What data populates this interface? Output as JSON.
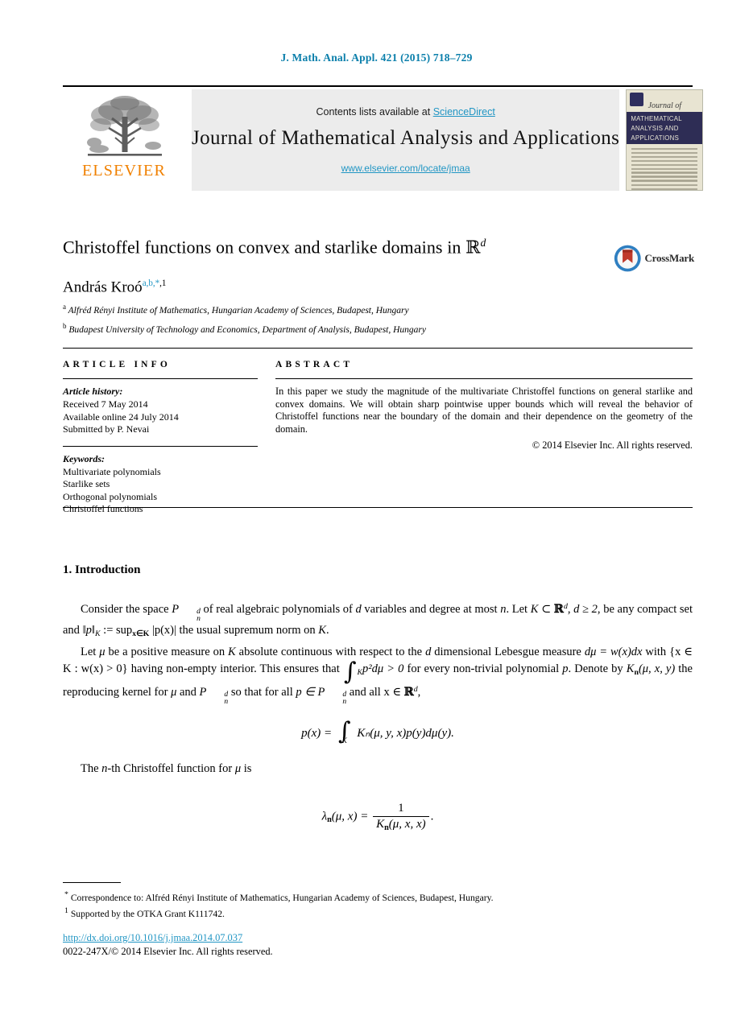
{
  "running_head": "J. Math. Anal. Appl. 421 (2015) 718–729",
  "masthead": {
    "contents_prefix": "Contents lists available at ",
    "sciencedirect": "ScienceDirect",
    "journal_title": "Journal of Mathematical Analysis and Applications",
    "journal_url": "www.elsevier.com/locate/jmaa",
    "publisher_wordmark": "ELSEVIER",
    "cover": {
      "script_word": "Journal of",
      "band_line1": "MATHEMATICAL",
      "band_line2": "ANALYSIS AND",
      "band_line3": "APPLICATIONS"
    }
  },
  "title": {
    "main": "Christoffel functions on convex and starlike domains in",
    "domain_symbol": "ℝ",
    "domain_exponent": "d"
  },
  "author": {
    "name": "András Kroó",
    "marks_linked": "a,b,*",
    "marks_plain": ",1"
  },
  "affiliations": [
    {
      "mark": "a",
      "text": "Alfréd Rényi Institute of Mathematics, Hungarian Academy of Sciences, Budapest, Hungary"
    },
    {
      "mark": "b",
      "text": "Budapest University of Technology and Economics, Department of Analysis, Budapest, Hungary"
    }
  ],
  "crossmark_label": "CrossMark",
  "article_info": {
    "heading": "ARTICLE INFO",
    "history_label": "Article history:",
    "history": [
      "Received 7 May 2014",
      "Available online 24 July 2014",
      "Submitted by P. Nevai"
    ],
    "keywords_label": "Keywords:",
    "keywords": [
      "Multivariate polynomials",
      "Starlike sets",
      "Orthogonal polynomials",
      "Christoffel functions"
    ]
  },
  "abstract": {
    "heading": "ABSTRACT",
    "text": "In this paper we study the magnitude of the multivariate Christoffel functions on general starlike and convex domains. We will obtain sharp pointwise upper bounds which will reveal the behavior of Christoffel functions near the boundary of the domain and their dependence on the geometry of the domain.",
    "copyright": "© 2014 Elsevier Inc. All rights reserved."
  },
  "body": {
    "section_number_title": "1. Introduction",
    "para1_parts": {
      "t1": "Consider the space ",
      "P": "P",
      "P_sub": "n",
      "P_sup": "d",
      "t2": " of real algebraic polynomials of ",
      "d1": "d",
      "t3": " variables and degree at most ",
      "n1": "n",
      "t4": ". Let ",
      "K1": "K",
      "subset": " ⊂ ",
      "Rbb": "ℝ",
      "Rbb_sup": "d",
      "t5": ", ",
      "dge": "d ≥ 2",
      "t6": ", be any compact set and ",
      "normp": "‖p‖",
      "normp_sub": "K",
      "t7": " := sup",
      "sup_sub": "x∈K",
      "t8": " |p(x)| the usual supremum norm on ",
      "K2": "K",
      "t9": "."
    },
    "para2_parts": {
      "t1": "Let ",
      "mu1": "μ",
      "t2": " be a positive measure on ",
      "K1": "K",
      "t3": " absolute continuous with respect to the ",
      "d1": "d",
      "t4": " dimensional Lebesgue measure ",
      "dmu": "dμ = w(x)dx",
      "t5": " with {x ∈ K : w(x) > 0} having non-empty interior. This ensures that ",
      "int": "∫",
      "int_sub": "K",
      "psq": "p²dμ > 0",
      "t6": " for every non-trivial polynomial ",
      "p1": "p",
      "t7": ". Denote by ",
      "Kn": "K",
      "Kn_sub": "n",
      "Kn_args": "(μ, x, y)",
      "t8": " the reproducing kernel for ",
      "mu2": "μ",
      "t9": " and ",
      "P2": "P",
      "P2_sub": "n",
      "P2_sup": "d",
      "t10": " so that for all ",
      "pin": "p ∈ ",
      "P3": "P",
      "P3_sub": "n",
      "P3_sup": "d",
      "t11": " and all x ∈ ",
      "Rbb2": "ℝ",
      "Rbb2_sup": "d",
      "t12": ","
    },
    "equation1": {
      "lhs": "p(x) =",
      "integral": "∫",
      "integral_limit": "K",
      "rhs": "Kₙ(μ, y, x)p(y)dμ(y)."
    },
    "para3": "The n-th Christoffel function for μ is",
    "para3_parts": {
      "t1": "The ",
      "n": "n",
      "t2": "-th Christoffel function for ",
      "mu": "μ",
      "t3": " is"
    },
    "equation2": {
      "lhs": "λ",
      "lhs_sub": "n",
      "lhs_args": "(μ, x) =",
      "numerator": "1",
      "denominator_K": "K",
      "denominator_sub": "n",
      "denominator_args": "(μ, x, x)",
      "period": "."
    }
  },
  "footnotes": [
    {
      "mark": "*",
      "text": "Correspondence to: Alfréd Rényi Institute of Mathematics, Hungarian Academy of Sciences, Budapest, Hungary."
    },
    {
      "mark": "1",
      "text": "Supported by the OTKA Grant K111742."
    }
  ],
  "doi": "http://dx.doi.org/10.1016/j.jmaa.2014.07.037",
  "issn_line": "0022-247X/© 2014 Elsevier Inc. All rights reserved.",
  "colors": {
    "link_blue": "#2196c4",
    "head_blue": "#0b7fab",
    "elsevier_orange": "#f08000",
    "cover_navy": "#2e2d55",
    "masthead_grey": "#ececec"
  }
}
